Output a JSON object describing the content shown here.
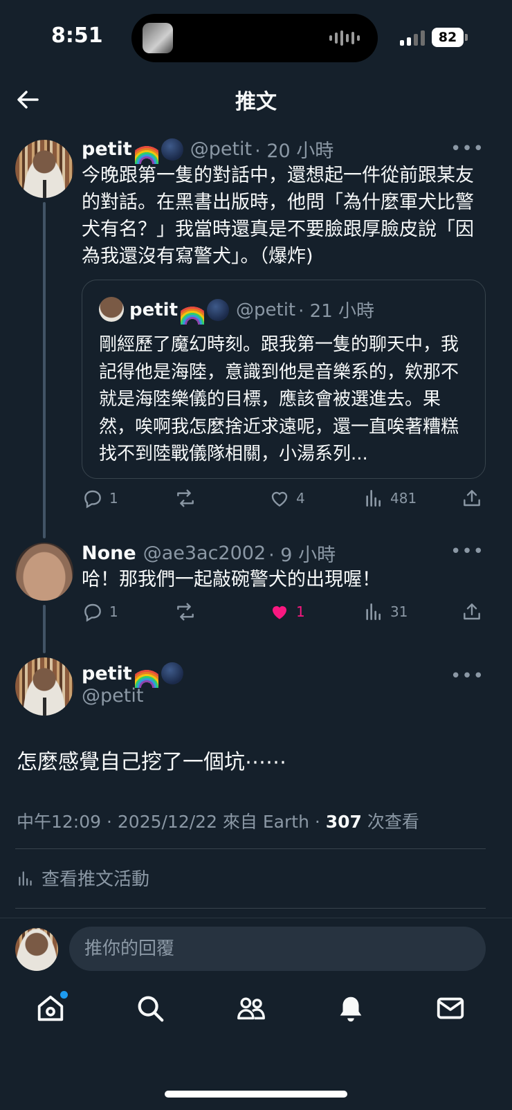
{
  "status_bar": {
    "time": "8:51",
    "battery": "82"
  },
  "header": {
    "title": "推文"
  },
  "tweet1": {
    "name": "petit",
    "handle": "@petit",
    "time": "· 20 小時",
    "text": "今晚跟第一隻的對話中，還想起一件從前跟某友的對話。在黑書出版時，他問「為什麼軍犬比警犬有名？」我當時還真是不要臉跟厚臉皮說「因為我還沒有寫警犬」。（爆炸)",
    "quote": {
      "name": "petit",
      "handle": "@petit",
      "time": "· 21 小時",
      "text": "剛經歷了魔幻時刻。跟我第一隻的聊天中，我記得他是海陸，意識到他是音樂系的，欸那不就是海陸樂儀的目標，應該會被選進去。果然，唉啊我怎麼捨近求遠呢，還一直唉著糟糕找不到陸戰儀隊相關，小湯系列..."
    },
    "replies": "1",
    "likes": "4",
    "views": "481"
  },
  "tweet2": {
    "name": "None",
    "handle": "@ae3ac2002",
    "time": "· 9 小時",
    "text": "哈！那我們一起敲碗警犬的出現喔！",
    "replies": "1",
    "likes": "1",
    "views": "31"
  },
  "main_tweet": {
    "name": "petit",
    "handle": "@petit",
    "text": "怎麼感覺自己挖了一個坑⋯⋯",
    "meta_prefix": "中午12:09 · 2025/12/22 來自 Earth · ",
    "views_count": "307",
    "views_suffix": " 次查看",
    "activity_label": "查看推文活動"
  },
  "reply": {
    "placeholder": "推你的回覆"
  },
  "icons": {
    "nav": [
      "home-icon",
      "search-icon",
      "communities-icon",
      "notifications-icon",
      "messages-icon"
    ],
    "actions": [
      "reply-icon",
      "retweet-icon",
      "like-icon",
      "views-icon",
      "share-icon"
    ]
  },
  "colors": {
    "background": "#15202b",
    "muted": "#8b98a5",
    "like_active": "#f91880",
    "accent": "#1d9bf0"
  }
}
